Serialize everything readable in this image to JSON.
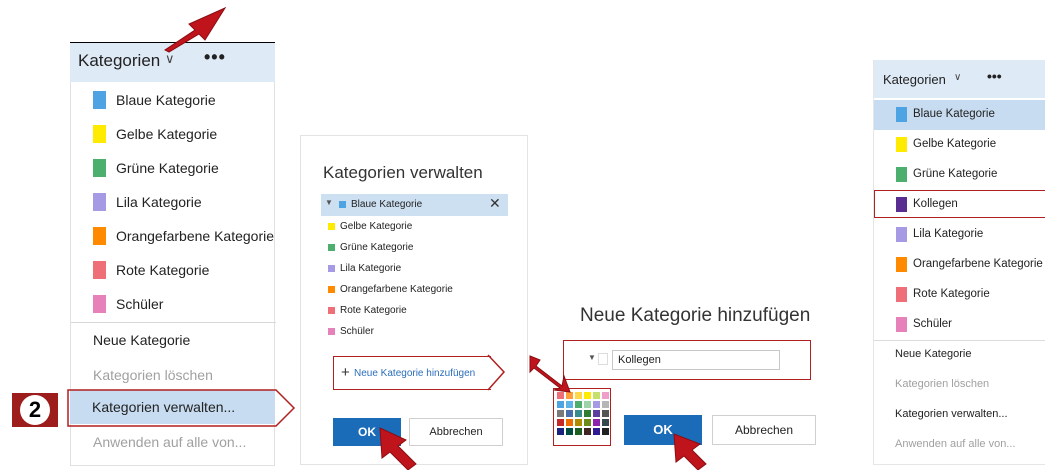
{
  "menu1": {
    "header_label": "Kategorien",
    "chevron": "chevron-down-icon",
    "more": "•••",
    "categories": [
      {
        "label": "Blaue Kategorie",
        "color": "#4ea3e3"
      },
      {
        "label": "Gelbe Kategorie",
        "color": "#ffeb00"
      },
      {
        "label": "Grüne Kategorie",
        "color": "#4caf6e"
      },
      {
        "label": "Lila Kategorie",
        "color": "#a59ae3"
      },
      {
        "label": "Orangefarbene Kategorie",
        "color": "#ff8a00"
      },
      {
        "label": "Rote Kategorie",
        "color": "#ef6f79"
      },
      {
        "label": "Schüler",
        "color": "#e681ba"
      }
    ],
    "new_category": "Neue Kategorie",
    "delete_categories": "Kategorien löschen",
    "manage_categories": "Kategorien verwalten...",
    "apply_all": "Anwenden auf alle von..."
  },
  "step_badge": "2",
  "manage_dialog": {
    "title": "Kategorien verwalten",
    "close": "✕",
    "expand": "▼",
    "categories": [
      {
        "label": "Blaue Kategorie",
        "color": "#4ea3e3"
      },
      {
        "label": "Gelbe Kategorie",
        "color": "#ffeb00"
      },
      {
        "label": "Grüne Kategorie",
        "color": "#4caf6e"
      },
      {
        "label": "Lila Kategorie",
        "color": "#a59ae3"
      },
      {
        "label": "Orangefarbene Kategorie",
        "color": "#ff8a00"
      },
      {
        "label": "Rote Kategorie",
        "color": "#ef6f79"
      },
      {
        "label": "Schüler",
        "color": "#e681ba"
      }
    ],
    "add_plus": "+",
    "add_link": "Neue Kategorie hinzufügen",
    "ok": "OK",
    "cancel": "Abbrechen"
  },
  "new_dialog": {
    "title": "Neue Kategorie hinzufügen",
    "input_value": "Kollegen",
    "ok": "OK",
    "cancel": "Abbrechen",
    "palette": [
      "#ef6f79",
      "#ff9c3c",
      "#ffd84a",
      "#ffeb00",
      "#c6e06b",
      "#f0a0c8",
      "#4ea3e3",
      "#5fb3e6",
      "#4caf6e",
      "#9dd3a8",
      "#a59ae3",
      "#b6b6b6",
      "#7a7a7a",
      "#4a6ea9",
      "#3a8c8c",
      "#2e7d32",
      "#5c3d9e",
      "#555555",
      "#c62828",
      "#ef6c00",
      "#b08d00",
      "#6d8b19",
      "#8e24aa",
      "#37474f",
      "#1a237e",
      "#004d40",
      "#1b5e20",
      "#3e2723",
      "#311b92",
      "#212121"
    ]
  },
  "menu2": {
    "header_label": "Kategorien",
    "chevron": "chevron-down-icon",
    "more": "•••",
    "categories": [
      {
        "label": "Blaue Kategorie",
        "color": "#4ea3e3"
      },
      {
        "label": "Gelbe Kategorie",
        "color": "#ffeb00"
      },
      {
        "label": "Grüne Kategorie",
        "color": "#4caf6e"
      },
      {
        "label": "Kollegen",
        "color": "#5a2d91"
      },
      {
        "label": "Lila Kategorie",
        "color": "#a59ae3"
      },
      {
        "label": "Orangefarbene Kategorie",
        "color": "#ff8a00"
      },
      {
        "label": "Rote Kategorie",
        "color": "#ef6f79"
      },
      {
        "label": "Schüler",
        "color": "#e681ba"
      }
    ],
    "new_category": "Neue Kategorie",
    "delete_categories": "Kategorien löschen",
    "manage_categories": "Kategorien verwalten...",
    "apply_all": "Anwenden auf alle von..."
  },
  "colors": {
    "accent_blue": "#1a6bb8",
    "highlight_red": "#b21f1f",
    "arrow_red": "#c0141c",
    "selection_bg": "#c7dcf0"
  }
}
